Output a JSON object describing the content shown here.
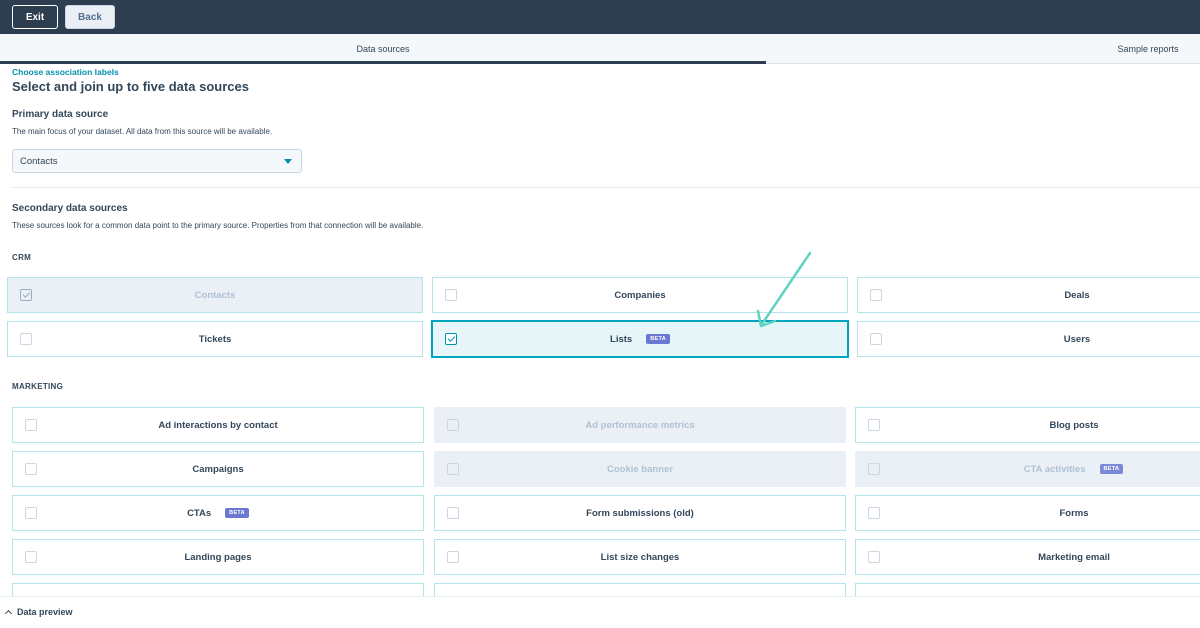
{
  "topbar": {
    "exit_label": "Exit",
    "back_label": "Back"
  },
  "tabs": [
    {
      "label": "Data sources",
      "active": true
    },
    {
      "label": "Sample reports",
      "active": false
    }
  ],
  "breadcrumb_link": "Choose association labels",
  "title": "Select and join up to five data sources",
  "primary": {
    "heading": "Primary data source",
    "description": "The main focus of your dataset. All data from this source will be available.",
    "selected": "Contacts"
  },
  "secondary": {
    "heading": "Secondary data sources",
    "description": "These sources look for a common data point to the primary source. Properties from that connection will be available."
  },
  "crm": {
    "label": "CRM",
    "items": [
      {
        "label": "Contacts",
        "checked": true,
        "disabled": true
      },
      {
        "label": "Companies",
        "checked": false,
        "disabled": false
      },
      {
        "label": "Deals",
        "checked": false,
        "disabled": false
      },
      {
        "label": "Tickets",
        "checked": false,
        "disabled": false
      },
      {
        "label": "Lists",
        "checked": true,
        "disabled": false,
        "badge": "BETA"
      },
      {
        "label": "Users",
        "checked": false,
        "disabled": false
      }
    ]
  },
  "marketing": {
    "label": "MARKETING",
    "items": [
      {
        "label": "Ad interactions by contact",
        "checked": false,
        "disabled": false
      },
      {
        "label": "Ad performance metrics",
        "checked": false,
        "disabled": true
      },
      {
        "label": "Blog posts",
        "checked": false,
        "disabled": false
      },
      {
        "label": "Campaigns",
        "checked": false,
        "disabled": false
      },
      {
        "label": "Cookie banner",
        "checked": false,
        "disabled": true
      },
      {
        "label": "CTA activities",
        "checked": false,
        "disabled": true,
        "badge": "BETA"
      },
      {
        "label": "CTAs",
        "checked": false,
        "disabled": false,
        "badge": "BETA"
      },
      {
        "label": "Form submissions (old)",
        "checked": false,
        "disabled": false
      },
      {
        "label": "Forms",
        "checked": false,
        "disabled": false
      },
      {
        "label": "Landing pages",
        "checked": false,
        "disabled": false
      },
      {
        "label": "List size changes",
        "checked": false,
        "disabled": false
      },
      {
        "label": "Marketing email",
        "checked": false,
        "disabled": false
      }
    ]
  },
  "footer": {
    "preview_label": "Data preview"
  },
  "colors": {
    "accent": "#00a4bd",
    "link": "#0091ae",
    "annotation_arrow": "#5fd3c4",
    "beta_badge": "#6a78d1"
  }
}
